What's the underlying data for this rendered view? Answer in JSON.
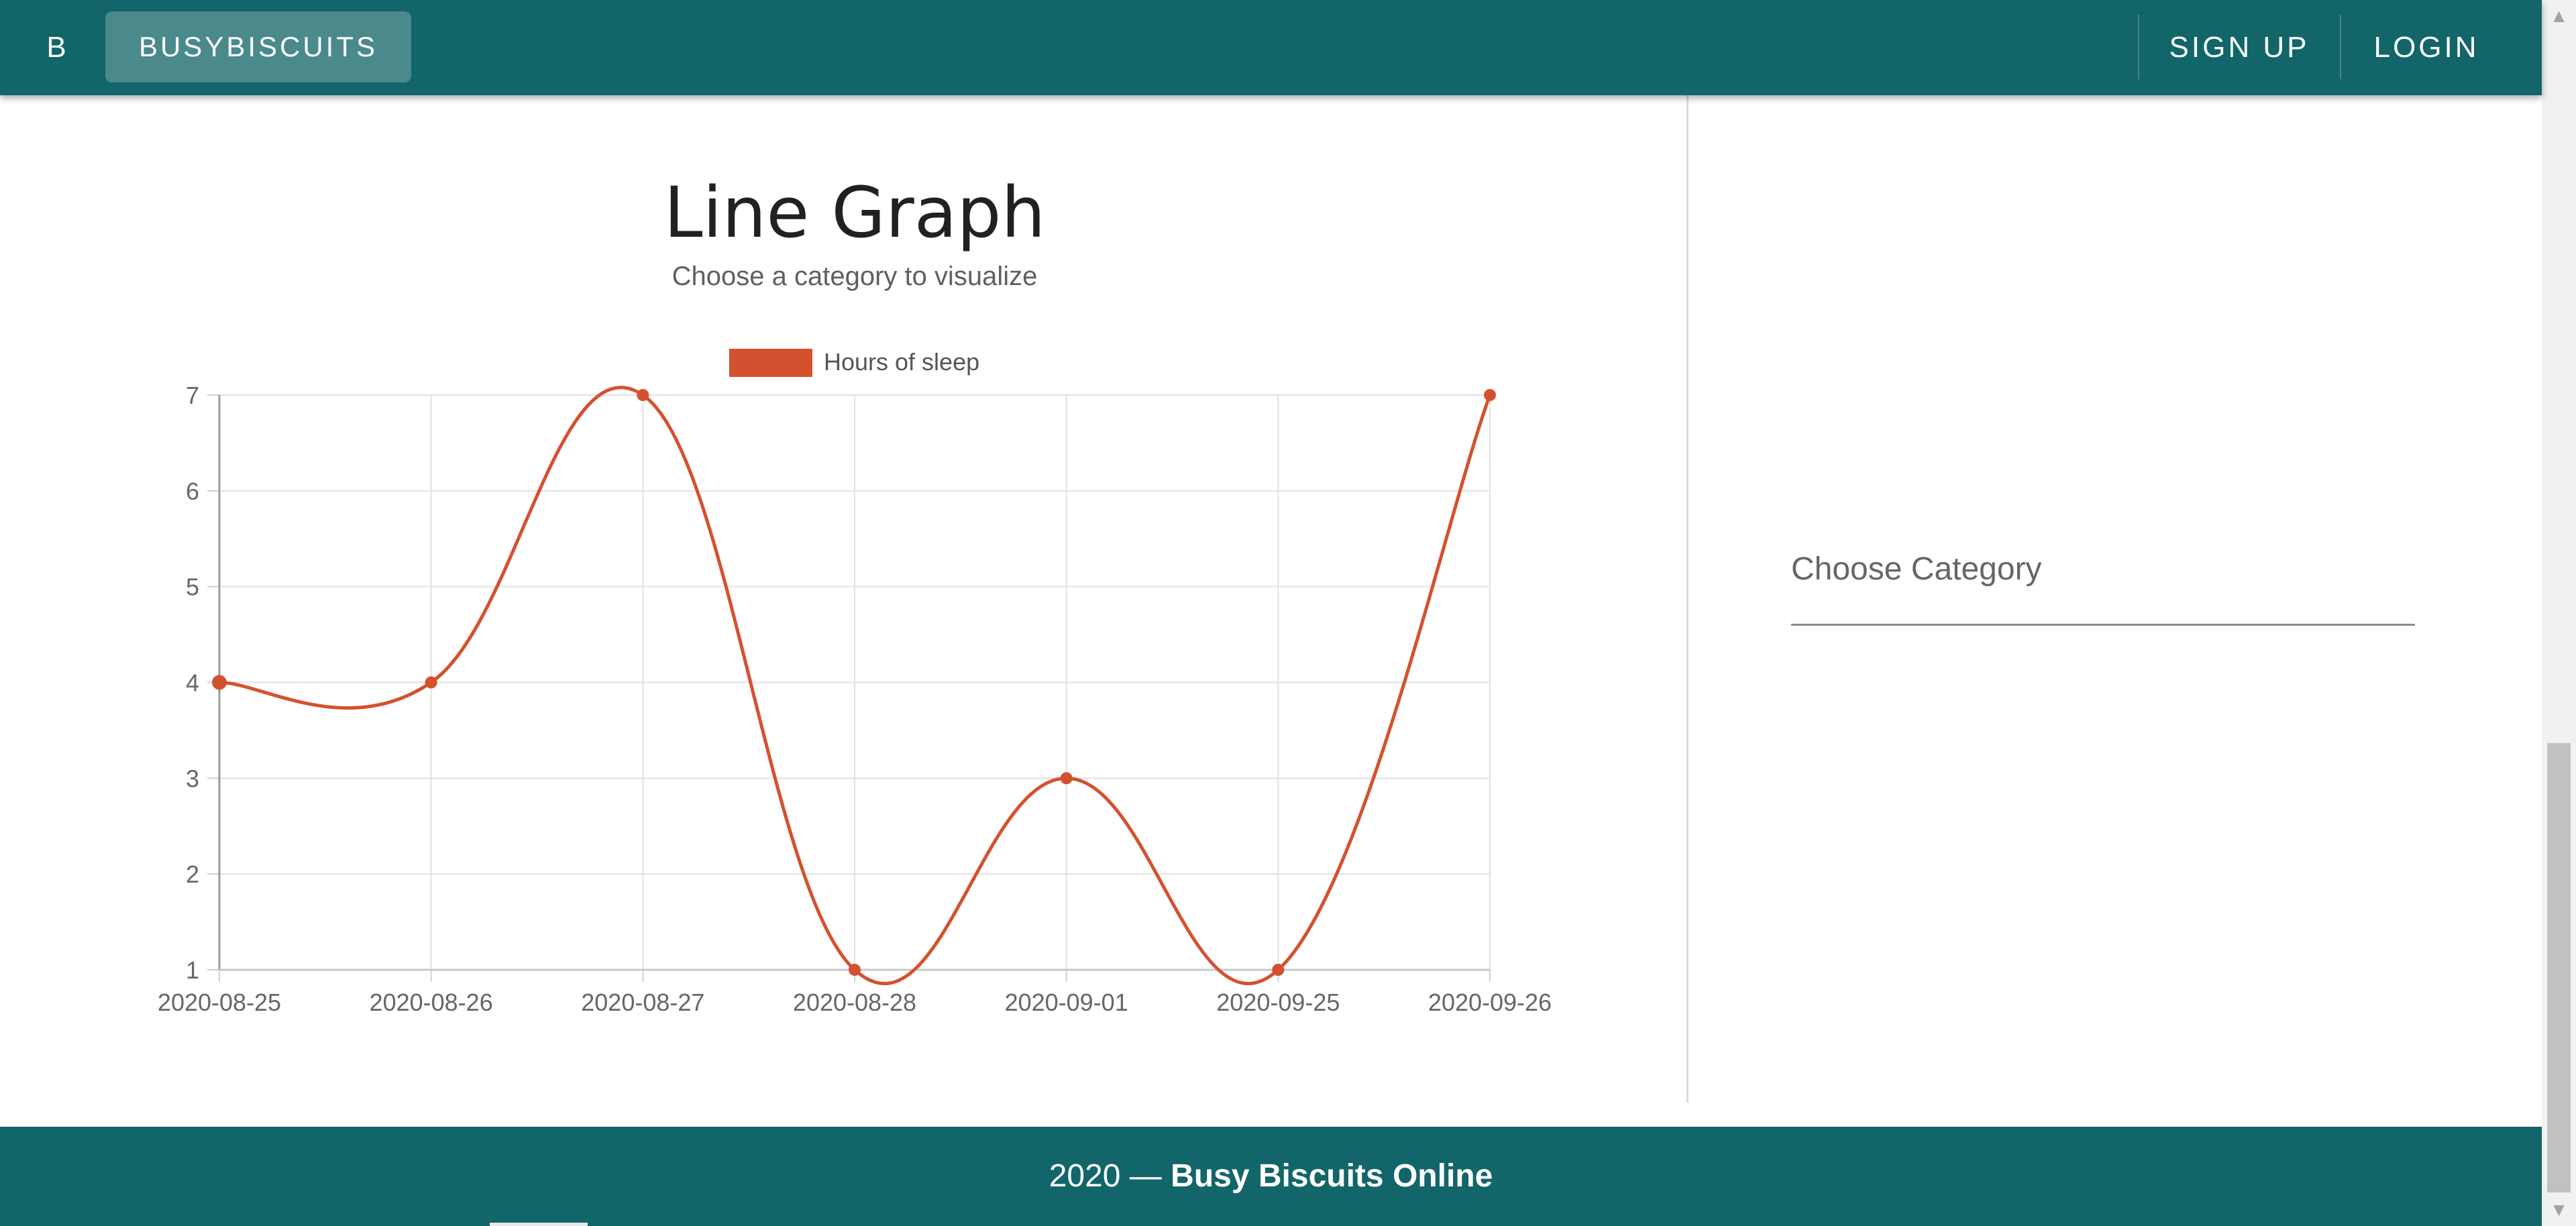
{
  "header": {
    "logo_letter": "B",
    "brand_label": "BUSYBISCUITS",
    "signup_label": "SIGN UP",
    "login_label": "LOGIN",
    "background_color": "#126568"
  },
  "main": {
    "title": "Line Graph",
    "subtitle": "Choose a category to visualize"
  },
  "category_select": {
    "label": "Choose Category",
    "selected_value": ""
  },
  "chart_data": {
    "type": "line",
    "title": "",
    "xlabel": "",
    "ylabel": "",
    "x": [
      "2020-08-25",
      "2020-08-26",
      "2020-08-27",
      "2020-08-28",
      "2020-09-01",
      "2020-09-25",
      "2020-09-26"
    ],
    "series": [
      {
        "name": "Hours of sleep",
        "values": [
          4,
          4,
          7,
          1,
          3,
          1,
          7
        ],
        "color": "#d4512f"
      }
    ],
    "ylim": [
      1,
      7
    ],
    "y_ticks": [
      1,
      2,
      3,
      4,
      5,
      6,
      7
    ],
    "grid": true,
    "legend_position": "top-center",
    "smooth": true
  },
  "footer": {
    "year_prefix": "2020 —",
    "site_name": "Busy Biscuits Online"
  },
  "scrollbar": {
    "up_arrow": "▲",
    "down_arrow": "▼"
  }
}
